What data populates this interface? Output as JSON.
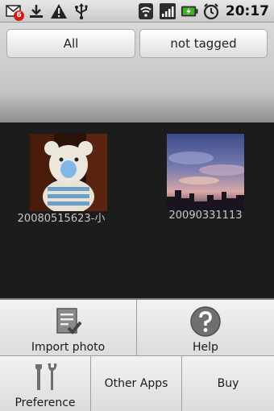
{
  "statusbar": {
    "time": "20:17",
    "notification_count": "6",
    "left_icons": [
      "gmail-notification-icon",
      "download-icon",
      "warning-icon",
      "usb-icon"
    ],
    "right_icons": [
      "wifi-icon",
      "signal-icon",
      "battery-charging-icon",
      "alarm-icon"
    ]
  },
  "tabs": [
    {
      "label": "All"
    },
    {
      "label": "not tagged"
    }
  ],
  "gallery": {
    "items": [
      {
        "label": "20080515623-小",
        "icon": "teddy-bear-photo"
      },
      {
        "label": "20090331113",
        "icon": "sunset-sky-photo"
      }
    ]
  },
  "menu": {
    "import": {
      "label": "Import photo",
      "icon": "import-photo-icon"
    },
    "help": {
      "label": "Help",
      "icon": "help-icon"
    },
    "preference": {
      "label": "Preference",
      "icon": "tools-icon"
    },
    "other_apps": {
      "label": "Other Apps"
    },
    "buy": {
      "label": "Buy"
    }
  },
  "colors": {
    "badge": "#d61d14",
    "gallery_bg": "#1c1c1c",
    "menu_bg": "#e6e6e6"
  }
}
